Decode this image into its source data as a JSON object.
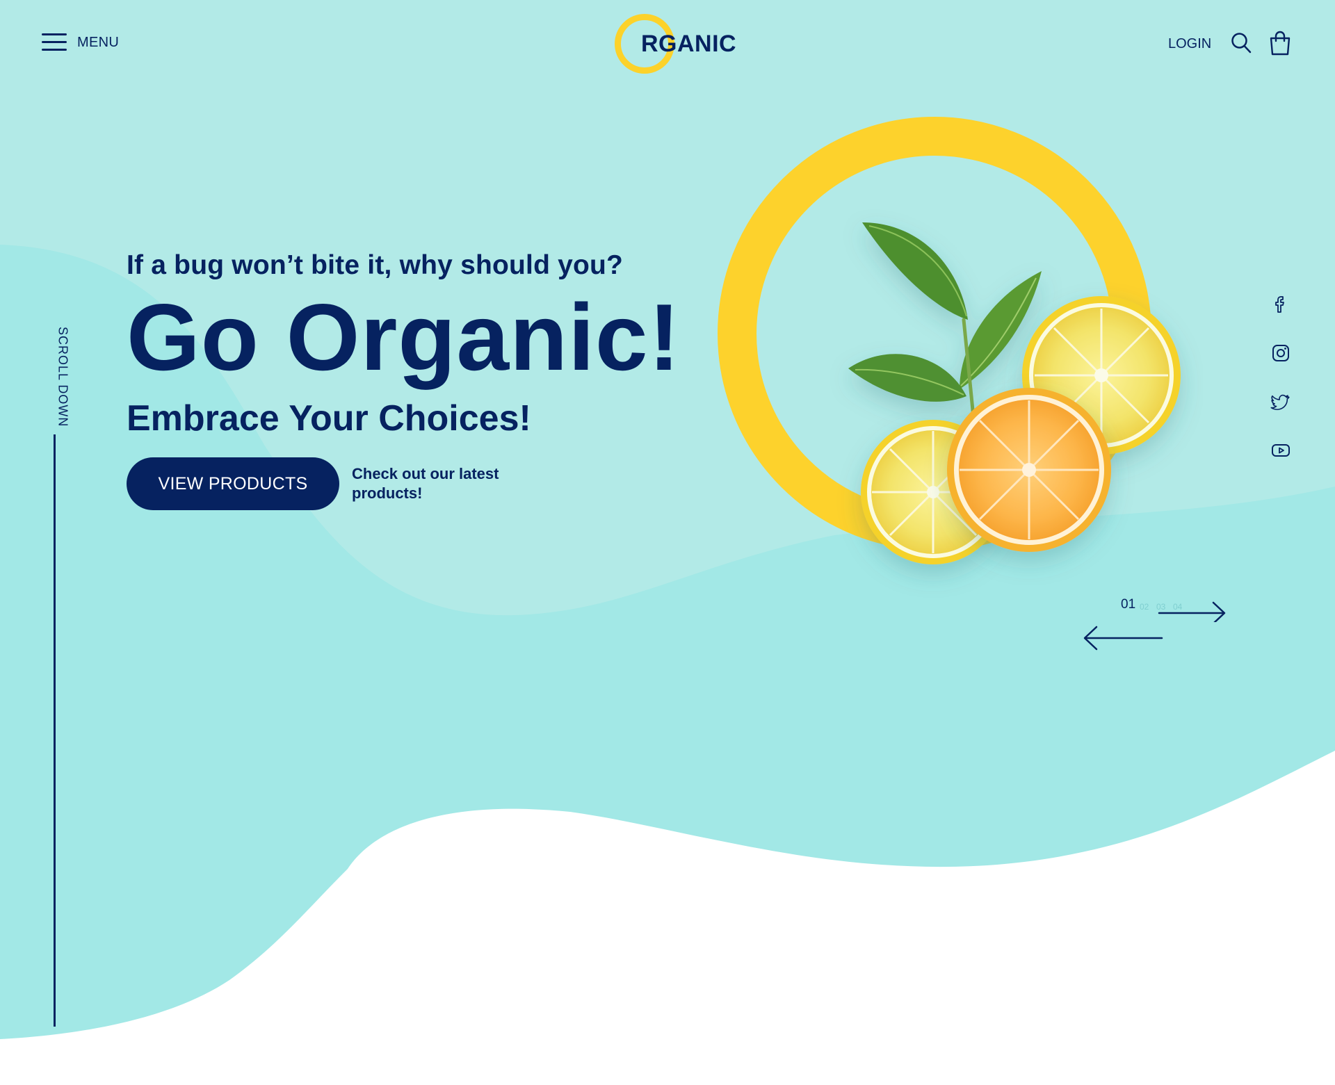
{
  "header": {
    "menu_label": "MENU",
    "logo_text": "RGANIC",
    "login_label": "LOGIN"
  },
  "hero": {
    "tagline": "If a bug won’t bite it, why should you?",
    "headline": "Go Organic!",
    "subheadline": "Embrace Your Choices!",
    "cta_label": "VIEW PRODUCTS",
    "cta_note": "Check out our latest products!"
  },
  "scroll": {
    "label": "SCROLL DOWN"
  },
  "slider": {
    "current": "01",
    "others": [
      "02",
      "03",
      "04"
    ]
  },
  "social": {
    "icons": [
      "facebook-icon",
      "instagram-icon",
      "twitter-icon",
      "youtube-icon"
    ]
  },
  "colors": {
    "navy": "#062260",
    "yellow": "#fcd22a",
    "teal_light": "#b0eae7",
    "teal": "#a0e8e6",
    "white": "#ffffff"
  }
}
